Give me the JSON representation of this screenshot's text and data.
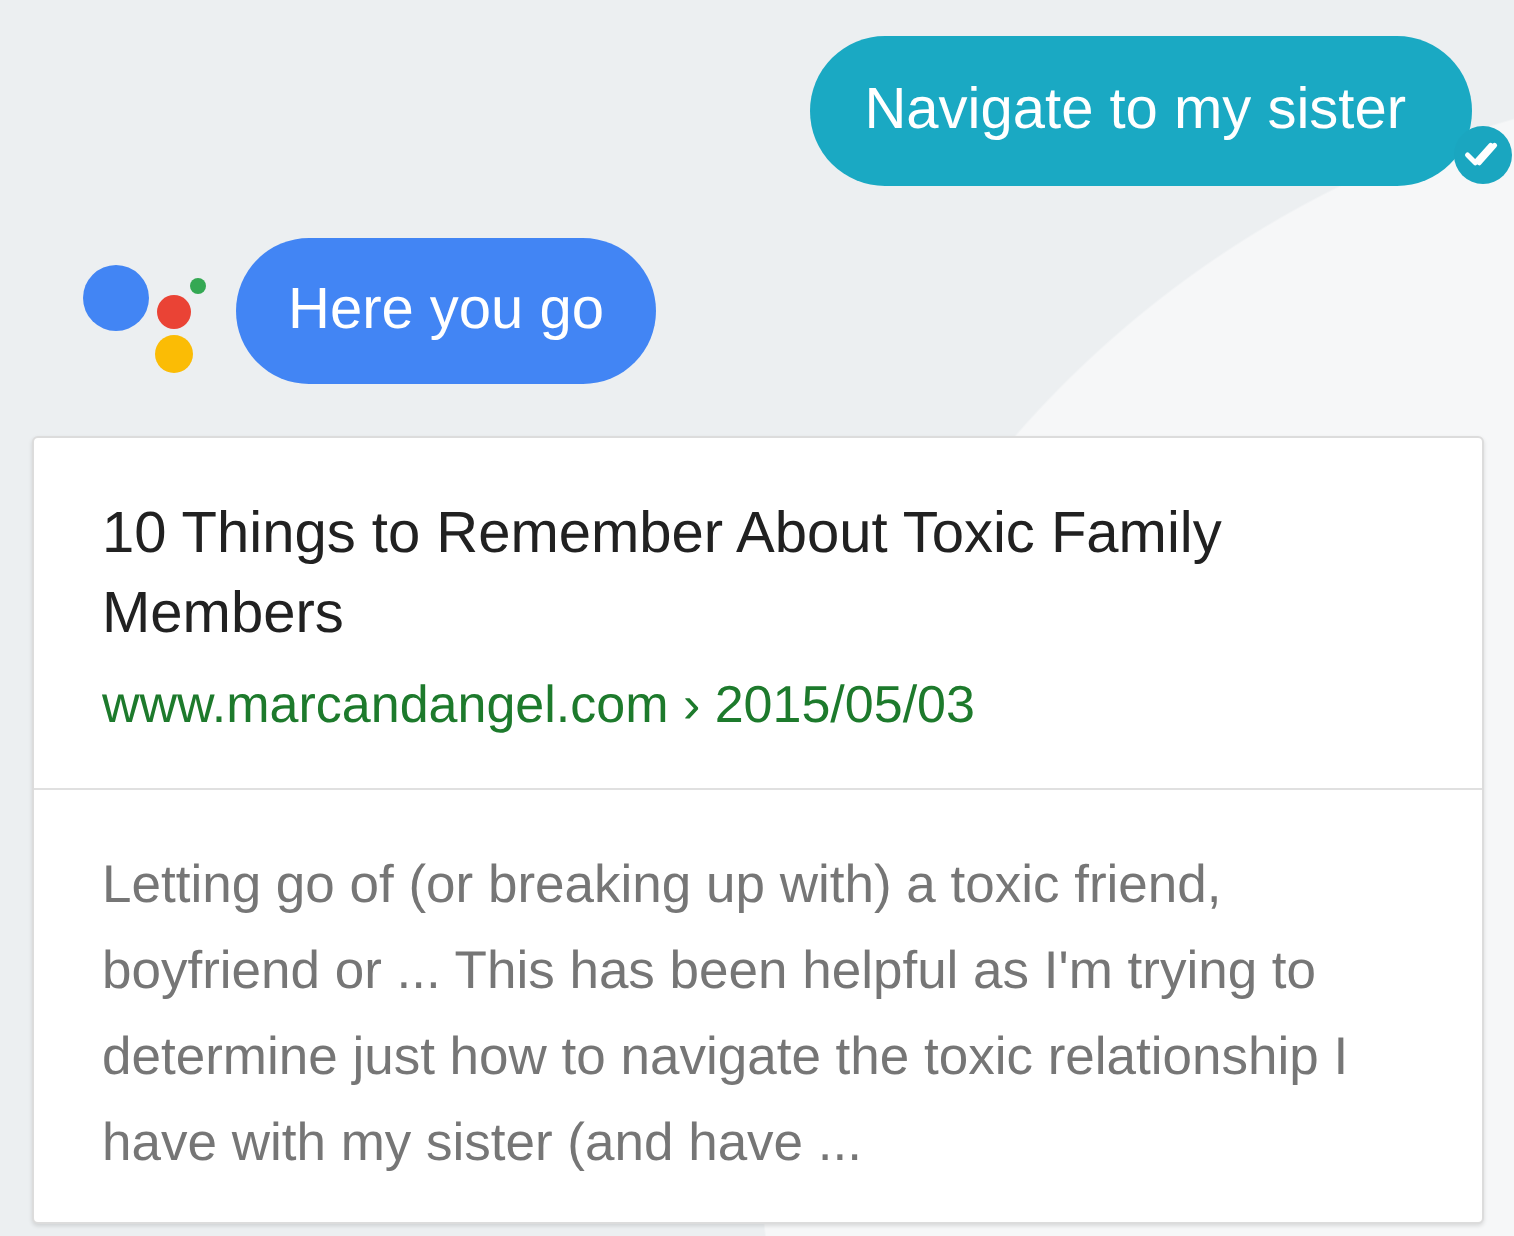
{
  "user_message": {
    "text": "Navigate to my sister",
    "delivered": true
  },
  "assistant_message": {
    "text": "Here you go"
  },
  "result_card": {
    "title": "10 Things to Remember About Toxic Family Members",
    "url": "www.marcandangel.com › 2015/05/03",
    "snippet": "Letting go of (or breaking up with) a toxic friend, boyfriend or ... This has been helpful as I'm trying to determine just how to navigate the toxic relationship I have with my sister (and have ..."
  }
}
